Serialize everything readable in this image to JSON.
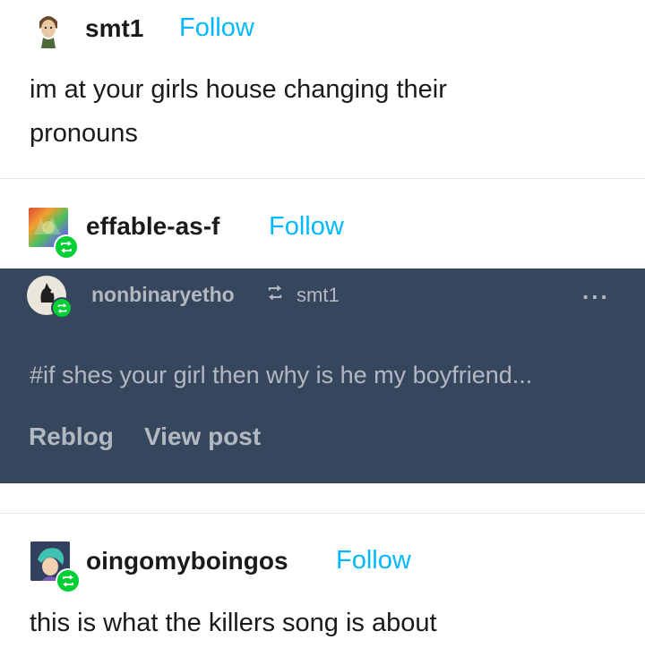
{
  "posts": [
    {
      "username": "smt1",
      "follow_label": "Follow",
      "text_lines": [
        "im at your girls house changing their",
        "pronouns"
      ]
    },
    {
      "username": "effable-as-f",
      "follow_label": "Follow"
    },
    {
      "username": "oingomyboingos",
      "follow_label": "Follow",
      "text_lines": [
        "this is what the killers song is about"
      ]
    }
  ],
  "reblog_card": {
    "username": "nonbinaryetho",
    "reblogged_from": "smt1",
    "more_menu": "...",
    "tags": "#if shes your girl then why is he my boyfriend...",
    "reblog_label": "Reblog",
    "view_post_label": "View post"
  },
  "colors": {
    "follow": "#00b8ff",
    "dark_panel": "#36465d",
    "reblog_badge": "#00cf35"
  }
}
